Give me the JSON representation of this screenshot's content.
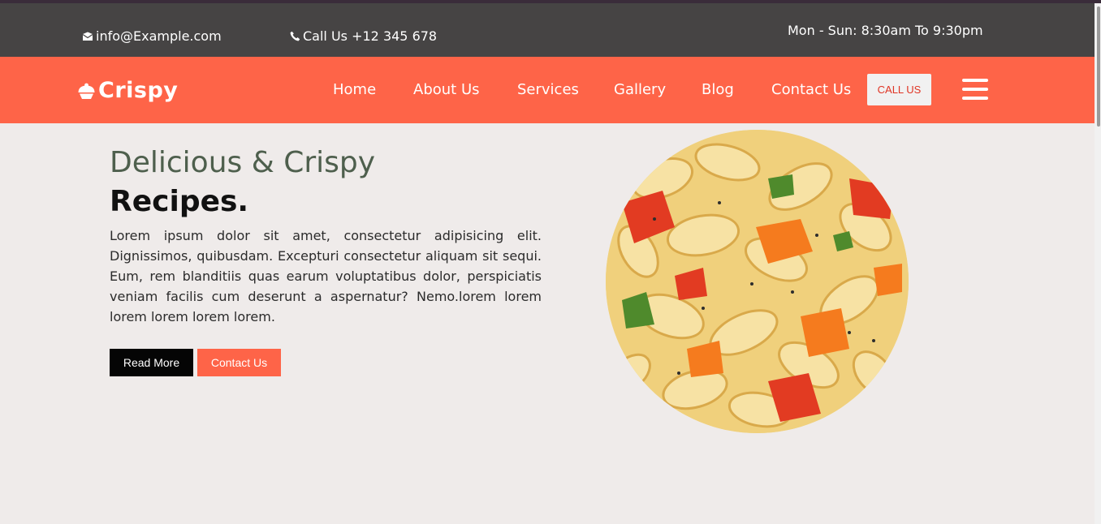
{
  "topbar": {
    "email": "info@Example.com",
    "phone": "Call Us +12 345 678",
    "hours": "Mon - Sun: 8:30am To 9:30pm"
  },
  "navbar": {
    "logo_text": "Crispy",
    "links": [
      {
        "label": "Home"
      },
      {
        "label": "About Us"
      },
      {
        "label": "Services"
      },
      {
        "label": "Gallery"
      },
      {
        "label": "Blog"
      },
      {
        "label": "Contact Us"
      }
    ],
    "call_button": "CALL US"
  },
  "hero": {
    "title_light": "Delicious & Crispy",
    "title_bold": "Recipes.",
    "paragraph": "Lorem ipsum dolor sit amet, consectetur adipisicing elit. Dignissimos, quibusdam. Excepturi consectetur aliquam sit sequi. Eum, rem blanditiis quas earum voluptatibus dolor, perspiciatis veniam facilis cum deserunt a aspernatur? Nemo.lorem lorem lorem lorem lorem lorem.",
    "read_more": "Read More",
    "contact_us": "Contact Us"
  },
  "colors": {
    "accent": "#fe6448",
    "topbar": "#464444",
    "background": "#efebea"
  },
  "icons": {
    "email": "envelope-icon",
    "phone": "phone-icon",
    "logo": "cloche-icon",
    "menu": "hamburger-menu-icon"
  }
}
